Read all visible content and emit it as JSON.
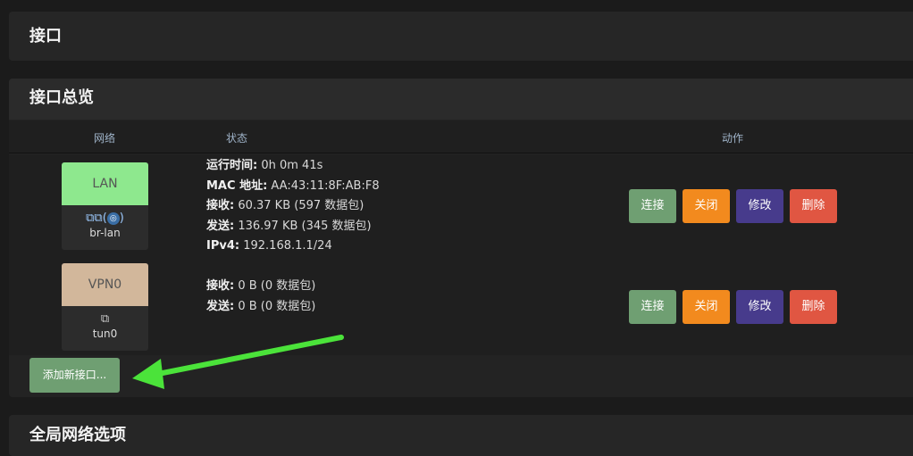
{
  "panels": {
    "interfaces_title": "接口",
    "overview_title": "接口总览",
    "global_title": "全局网络选项"
  },
  "table": {
    "col_network": "网络",
    "col_status": "状态",
    "col_actions": "动作"
  },
  "rows": [
    {
      "name": "LAN",
      "color": "#8ee88e",
      "device": "br-lan",
      "icons": "⚲⚲",
      "status": [
        {
          "label": "运行时间:",
          "value": " 0h 0m 41s"
        },
        {
          "label": "MAC 地址:",
          "value": " AA:43:11:8F:AB:F8"
        },
        {
          "label": "接收:",
          "value": " 60.37 KB (597 数据包)"
        },
        {
          "label": "发送:",
          "value": " 136.97 KB (345 数据包)"
        },
        {
          "label": "IPv4:",
          "value": " 192.168.1.1/24"
        }
      ]
    },
    {
      "name": "VPN0",
      "color": "#d2b79b",
      "device": "tun0",
      "icons": "⚲",
      "status": [
        {
          "label": "接收:",
          "value": " 0 B (0 数据包)"
        },
        {
          "label": "发送:",
          "value": " 0 B (0 数据包)"
        }
      ]
    }
  ],
  "buttons": {
    "connect": "连接",
    "close": "关闭",
    "edit": "修改",
    "delete": "删除",
    "add_interface": "添加新接口..."
  },
  "colors": {
    "annotation_arrow": "#4be33a"
  }
}
